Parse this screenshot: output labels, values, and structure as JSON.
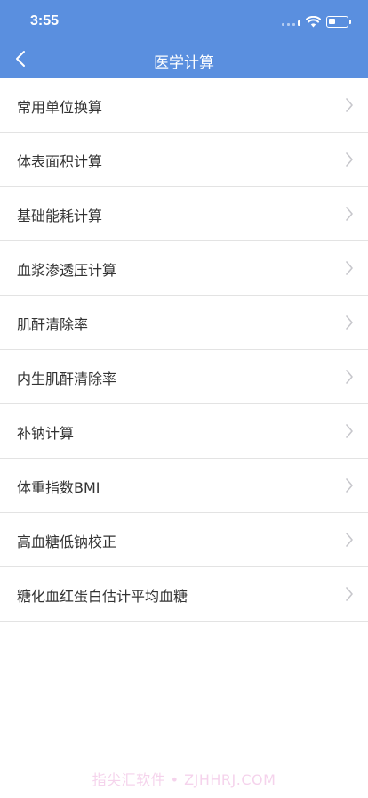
{
  "status_bar": {
    "time": "3:55"
  },
  "nav": {
    "title": "医学计算",
    "back_icon": "chevron-left-icon"
  },
  "list": {
    "chevron_icon": "chevron-right-icon",
    "items": [
      {
        "label": "常用单位换算"
      },
      {
        "label": "体表面积计算"
      },
      {
        "label": "基础能耗计算"
      },
      {
        "label": "血浆渗透压计算"
      },
      {
        "label": "肌酐清除率"
      },
      {
        "label": "内生肌酐清除率"
      },
      {
        "label": "补钠计算"
      },
      {
        "label": "体重指数BMI"
      },
      {
        "label": "高血糖低钠校正"
      },
      {
        "label": "糖化血红蛋白估计平均血糖"
      }
    ]
  },
  "watermark": "指尖汇软件 • ZJHHRJ.COM",
  "colors": {
    "header": "#5a8fdf",
    "text": "#333333",
    "divider": "#e3e3e3",
    "chevron": "#c7c7cc"
  }
}
